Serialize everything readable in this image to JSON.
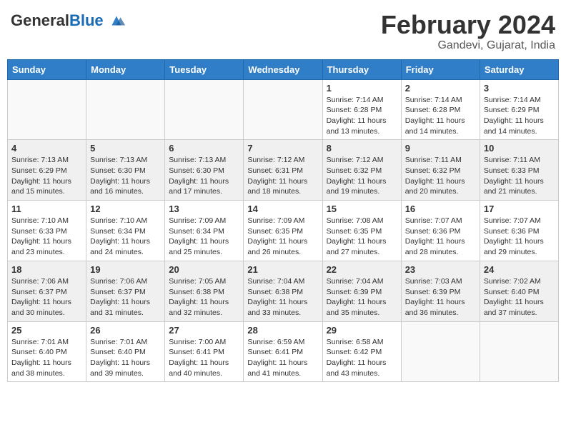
{
  "header": {
    "logo_general": "General",
    "logo_blue": "Blue",
    "month": "February 2024",
    "location": "Gandevi, Gujarat, India"
  },
  "days_of_week": [
    "Sunday",
    "Monday",
    "Tuesday",
    "Wednesday",
    "Thursday",
    "Friday",
    "Saturday"
  ],
  "weeks": [
    {
      "shaded": false,
      "days": [
        {
          "num": "",
          "info": ""
        },
        {
          "num": "",
          "info": ""
        },
        {
          "num": "",
          "info": ""
        },
        {
          "num": "",
          "info": ""
        },
        {
          "num": "1",
          "info": "Sunrise: 7:14 AM\nSunset: 6:28 PM\nDaylight: 11 hours\nand 13 minutes."
        },
        {
          "num": "2",
          "info": "Sunrise: 7:14 AM\nSunset: 6:28 PM\nDaylight: 11 hours\nand 14 minutes."
        },
        {
          "num": "3",
          "info": "Sunrise: 7:14 AM\nSunset: 6:29 PM\nDaylight: 11 hours\nand 14 minutes."
        }
      ]
    },
    {
      "shaded": true,
      "days": [
        {
          "num": "4",
          "info": "Sunrise: 7:13 AM\nSunset: 6:29 PM\nDaylight: 11 hours\nand 15 minutes."
        },
        {
          "num": "5",
          "info": "Sunrise: 7:13 AM\nSunset: 6:30 PM\nDaylight: 11 hours\nand 16 minutes."
        },
        {
          "num": "6",
          "info": "Sunrise: 7:13 AM\nSunset: 6:30 PM\nDaylight: 11 hours\nand 17 minutes."
        },
        {
          "num": "7",
          "info": "Sunrise: 7:12 AM\nSunset: 6:31 PM\nDaylight: 11 hours\nand 18 minutes."
        },
        {
          "num": "8",
          "info": "Sunrise: 7:12 AM\nSunset: 6:32 PM\nDaylight: 11 hours\nand 19 minutes."
        },
        {
          "num": "9",
          "info": "Sunrise: 7:11 AM\nSunset: 6:32 PM\nDaylight: 11 hours\nand 20 minutes."
        },
        {
          "num": "10",
          "info": "Sunrise: 7:11 AM\nSunset: 6:33 PM\nDaylight: 11 hours\nand 21 minutes."
        }
      ]
    },
    {
      "shaded": false,
      "days": [
        {
          "num": "11",
          "info": "Sunrise: 7:10 AM\nSunset: 6:33 PM\nDaylight: 11 hours\nand 23 minutes."
        },
        {
          "num": "12",
          "info": "Sunrise: 7:10 AM\nSunset: 6:34 PM\nDaylight: 11 hours\nand 24 minutes."
        },
        {
          "num": "13",
          "info": "Sunrise: 7:09 AM\nSunset: 6:34 PM\nDaylight: 11 hours\nand 25 minutes."
        },
        {
          "num": "14",
          "info": "Sunrise: 7:09 AM\nSunset: 6:35 PM\nDaylight: 11 hours\nand 26 minutes."
        },
        {
          "num": "15",
          "info": "Sunrise: 7:08 AM\nSunset: 6:35 PM\nDaylight: 11 hours\nand 27 minutes."
        },
        {
          "num": "16",
          "info": "Sunrise: 7:07 AM\nSunset: 6:36 PM\nDaylight: 11 hours\nand 28 minutes."
        },
        {
          "num": "17",
          "info": "Sunrise: 7:07 AM\nSunset: 6:36 PM\nDaylight: 11 hours\nand 29 minutes."
        }
      ]
    },
    {
      "shaded": true,
      "days": [
        {
          "num": "18",
          "info": "Sunrise: 7:06 AM\nSunset: 6:37 PM\nDaylight: 11 hours\nand 30 minutes."
        },
        {
          "num": "19",
          "info": "Sunrise: 7:06 AM\nSunset: 6:37 PM\nDaylight: 11 hours\nand 31 minutes."
        },
        {
          "num": "20",
          "info": "Sunrise: 7:05 AM\nSunset: 6:38 PM\nDaylight: 11 hours\nand 32 minutes."
        },
        {
          "num": "21",
          "info": "Sunrise: 7:04 AM\nSunset: 6:38 PM\nDaylight: 11 hours\nand 33 minutes."
        },
        {
          "num": "22",
          "info": "Sunrise: 7:04 AM\nSunset: 6:39 PM\nDaylight: 11 hours\nand 35 minutes."
        },
        {
          "num": "23",
          "info": "Sunrise: 7:03 AM\nSunset: 6:39 PM\nDaylight: 11 hours\nand 36 minutes."
        },
        {
          "num": "24",
          "info": "Sunrise: 7:02 AM\nSunset: 6:40 PM\nDaylight: 11 hours\nand 37 minutes."
        }
      ]
    },
    {
      "shaded": false,
      "days": [
        {
          "num": "25",
          "info": "Sunrise: 7:01 AM\nSunset: 6:40 PM\nDaylight: 11 hours\nand 38 minutes."
        },
        {
          "num": "26",
          "info": "Sunrise: 7:01 AM\nSunset: 6:40 PM\nDaylight: 11 hours\nand 39 minutes."
        },
        {
          "num": "27",
          "info": "Sunrise: 7:00 AM\nSunset: 6:41 PM\nDaylight: 11 hours\nand 40 minutes."
        },
        {
          "num": "28",
          "info": "Sunrise: 6:59 AM\nSunset: 6:41 PM\nDaylight: 11 hours\nand 41 minutes."
        },
        {
          "num": "29",
          "info": "Sunrise: 6:58 AM\nSunset: 6:42 PM\nDaylight: 11 hours\nand 43 minutes."
        },
        {
          "num": "",
          "info": ""
        },
        {
          "num": "",
          "info": ""
        }
      ]
    }
  ]
}
